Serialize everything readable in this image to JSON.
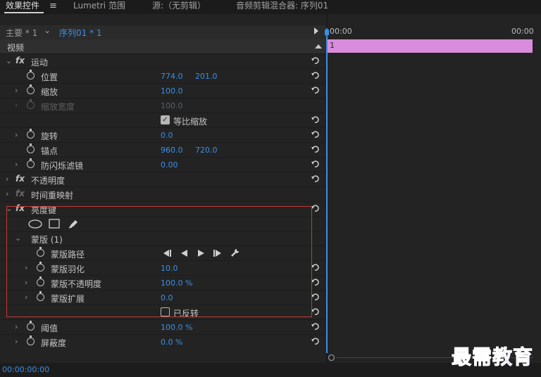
{
  "tabs": [
    {
      "label": "效果控件"
    },
    {
      "label": "Lumetri 范围"
    },
    {
      "label": "源:（无剪辑）"
    },
    {
      "label": "音频剪辑混合器: 序列01"
    }
  ],
  "sequence_bar": {
    "master": "主要 * 1",
    "sequence": "序列01 * 1"
  },
  "section_video": "视频",
  "effects": {
    "motion": {
      "name": "运动",
      "position": {
        "label": "位置",
        "x": "774.0",
        "y": "201.0"
      },
      "scale": {
        "label": "缩放",
        "value": "100.0"
      },
      "scale_width": {
        "label": "缩放宽度",
        "value": "100.0"
      },
      "uniform_scale": {
        "label": "等比缩放",
        "checked": true
      },
      "rotation": {
        "label": "旋转",
        "value": "0.0"
      },
      "anchor": {
        "label": "锚点",
        "x": "960.0",
        "y": "720.0"
      },
      "anti_flicker": {
        "label": "防闪烁滤镜",
        "value": "0.00"
      }
    },
    "opacity": {
      "name": "不透明度"
    },
    "time_remap": {
      "name": "时间重映射"
    },
    "luma_key": {
      "name": "亮度键",
      "mask": {
        "name": "蒙版 (1)",
        "path": {
          "label": "蒙版路径"
        },
        "feather": {
          "label": "蒙版羽化",
          "value": "10.0"
        },
        "opacity": {
          "label": "蒙版不透明度",
          "value": "100.0 %"
        },
        "expansion": {
          "label": "蒙版扩展",
          "value": "0.0"
        },
        "inverted": {
          "label": "已反转",
          "checked": false
        }
      },
      "threshold": {
        "label": "阈值",
        "value": "100.0 %"
      },
      "cutoff": {
        "label": "屏蔽度",
        "value": "0.0 %"
      }
    }
  },
  "timeline": {
    "start_time": "00:00",
    "end_time": "00:00",
    "clip_label": "1",
    "clip_color": "#d98bdc"
  },
  "status": {
    "timecode": "00:00:00:00"
  },
  "watermark": "最需教育",
  "colors": {
    "accent": "#3b8fe6",
    "highlight_box": "#c23a3a"
  }
}
